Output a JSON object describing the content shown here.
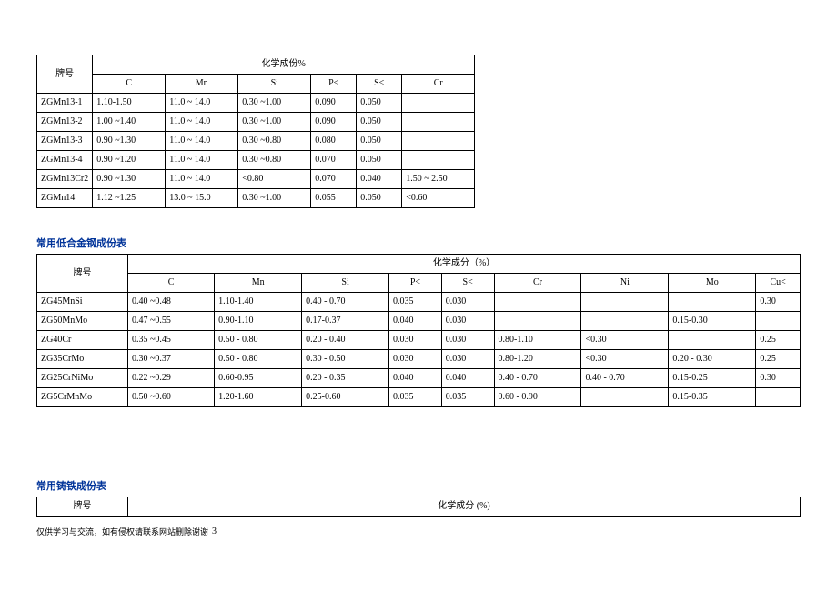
{
  "table1": {
    "header_grade": "牌号",
    "header_chem": "化学成份%",
    "cols": [
      "C",
      "Mn",
      "Si",
      "P<",
      "S<",
      "Cr"
    ],
    "rows": [
      [
        "ZGMn13-1",
        "1.10-1.50",
        "11.0 ~ 14.0",
        "0.30 ~1.00",
        "0.090",
        "0.050",
        ""
      ],
      [
        "ZGMn13-2",
        "1.00 ~1.40",
        "11.0 ~ 14.0",
        "0.30 ~1.00",
        "0.090",
        "0.050",
        ""
      ],
      [
        "ZGMn13-3",
        "0.90 ~1.30",
        "11.0 ~ 14.0",
        "0.30 ~0.80",
        "0.080",
        "0.050",
        ""
      ],
      [
        "ZGMn13-4",
        "0.90 ~1.20",
        "11.0 ~ 14.0",
        "0.30 ~0.80",
        "0.070",
        "0.050",
        ""
      ],
      [
        "ZGMn13Cr2",
        "0.90 ~1.30",
        "11.0 ~ 14.0",
        "<0.80",
        "0.070",
        "0.040",
        "1.50 ~ 2.50"
      ],
      [
        "ZGMn14",
        "1.12 ~1.25",
        "13.0 ~ 15.0",
        "0.30 ~1.00",
        "0.055",
        "0.050",
        "<0.60"
      ]
    ]
  },
  "section2_title": "常用低合金钢成份表",
  "table2": {
    "header_grade": "牌号",
    "header_chem": "化学成分（%）",
    "cols": [
      "C",
      "Mn",
      "Si",
      "P<",
      "S<",
      "Cr",
      "Ni",
      "Mo",
      "Cu<"
    ],
    "rows": [
      [
        "ZG45MnSi",
        "0.40 ~0.48",
        "1.10-1.40",
        "0.40 - 0.70",
        "0.035",
        "0.030",
        "",
        "",
        "",
        "0.30"
      ],
      [
        "ZG50MnMo",
        "0.47 ~0.55",
        "0.90-1.10",
        "0.17-0.37",
        "0.040",
        "0.030",
        "",
        "",
        "0.15-0.30",
        ""
      ],
      [
        "ZG40Cr",
        "0.35 ~0.45",
        "0.50 - 0.80",
        "0.20 - 0.40",
        "0.030",
        "0.030",
        "0.80-1.10",
        "<0.30",
        "",
        "0.25"
      ],
      [
        "ZG35CrMo",
        "0.30 ~0.37",
        "0.50 - 0.80",
        "0.30 - 0.50",
        "0.030",
        "0.030",
        "0.80-1.20",
        "<0.30",
        "0.20 - 0.30",
        "0.25"
      ],
      [
        "ZG25CrNiMo",
        "0.22 ~0.29",
        "0.60-0.95",
        "0.20 - 0.35",
        "0.040",
        "0.040",
        "0.40 - 0.70",
        "0.40 - 0.70",
        "0.15-0.25",
        "0.30"
      ],
      [
        "ZG5CrMnMo",
        "0.50 ~0.60",
        "1.20-1.60",
        "0.25-0.60",
        "0.035",
        "0.035",
        "0.60 - 0.90",
        "",
        "0.15-0.35",
        ""
      ]
    ]
  },
  "section3_title": "常用铸铁成份表",
  "table3": {
    "header_grade": "牌号",
    "header_chem": "化学成分 (%)"
  },
  "footer_text": "仅供学习与交流，如有侵权请联系网站删除谢谢",
  "page_number": "3"
}
